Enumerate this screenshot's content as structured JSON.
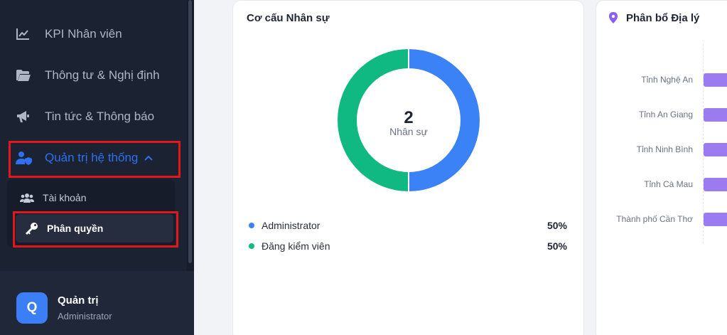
{
  "sidebar": {
    "items": [
      {
        "label": "KPI Nhân viên",
        "icon": "chart-line-icon"
      },
      {
        "label": "Thông tư & Nghị định",
        "icon": "folder-open-icon"
      },
      {
        "label": "Tin tức & Thông báo",
        "icon": "megaphone-icon"
      },
      {
        "label": "Quản trị hệ thống",
        "icon": "user-shield-icon",
        "active": true,
        "expanded": true
      }
    ],
    "submenu": [
      {
        "label": "Tài khoản",
        "icon": "users-icon"
      },
      {
        "label": "Phân quyền",
        "icon": "key-icon",
        "selected": true
      }
    ],
    "profile": {
      "initial": "Q",
      "name": "Quản trị",
      "role": "Administrator"
    }
  },
  "staff_structure": {
    "title": "Cơ cấu Nhân sự",
    "total": "2",
    "total_label": "Nhân sự",
    "chart_data": {
      "type": "pie",
      "categories": [
        "Administrator",
        "Đăng kiểm viên"
      ],
      "values": [
        50,
        50
      ],
      "colors": [
        "#3b82f6",
        "#10b981"
      ]
    },
    "legend": [
      {
        "label": "Administrator",
        "pct": "50%",
        "color": "#3b82f6"
      },
      {
        "label": "Đăng kiểm viên",
        "pct": "50%",
        "color": "#10b981"
      }
    ]
  },
  "geo": {
    "title": "Phân bổ Địa lý",
    "provinces": [
      "Tỉnh Nghệ An",
      "Tỉnh An Giang",
      "Tỉnh Ninh Bình",
      "Tỉnh Cà Mau",
      "Thành phố Cần Thơ"
    ],
    "bar_color": "#9b7cf0"
  },
  "colors": {
    "accent": "#2f6ff0",
    "highlight": "#e3161c",
    "sidebar_bg": "#1b2232"
  }
}
